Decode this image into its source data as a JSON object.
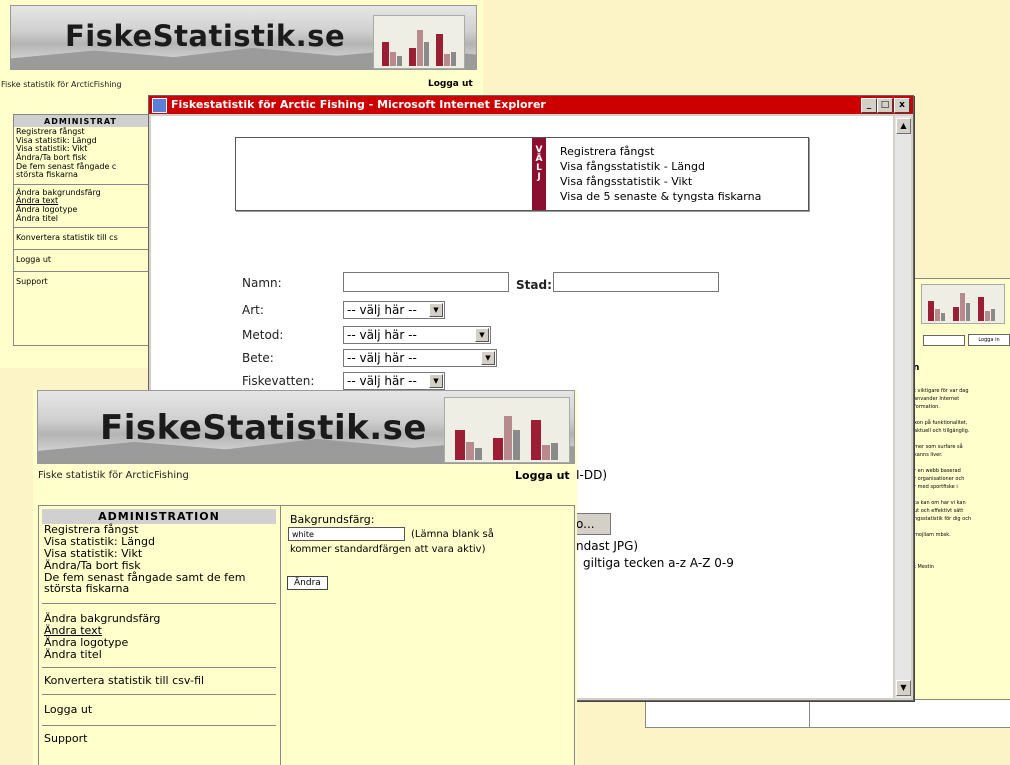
{
  "site": {
    "brand": "FiskeStatistik.se",
    "tagline": "Fiske statistik för ArcticFishing",
    "logout": "Logga ut"
  },
  "menu": {
    "heading": "ADMINISTRATION",
    "heading_cut": "ADMINISTRAT",
    "group1": [
      "Registrera fångst",
      "Visa statistik: Längd",
      "Visa statistik: Vikt",
      "Ändra/Ta bort fisk",
      "De fem senast fångade samt de fem",
      "största fiskarna"
    ],
    "group1_back_line5": "De fem senast fångade c",
    "group2": [
      "Ändra bakgrundsfärg",
      "Ändra text",
      "Ändra logotype",
      "Ändra titel"
    ],
    "convert": "Konvertera statistik till csv-fil",
    "convert_cut": "Konvertera statistik till cs",
    "logout": "Logga ut",
    "support": "Support"
  },
  "settings": {
    "label": "Bakgrundsfärg:",
    "value": "white",
    "hint1": "(Lämna blank så",
    "hint2": "kommer standardfärgen att vara aktiv)",
    "button": "Ändra"
  },
  "ie": {
    "title": "Fiskestatistik för Arctic Fishing - Microsoft Internet Explorer",
    "min": "_",
    "max": "□",
    "close": "x",
    "valj": [
      "V",
      "Ä",
      "L",
      "J"
    ],
    "nav": [
      "Registrera fångst",
      "Visa fångsstatistik - Längd",
      "Visa fångsstatistik - Vikt",
      "Visa de 5 senaste & tyngsta fiskarna"
    ],
    "form": {
      "namn": "Namn:",
      "stad": "Stad:",
      "art": "Art:",
      "metod": "Metod:",
      "bete": "Bete:",
      "fiskevatten": "Fiskevatten:",
      "select_short": "-- välj här --",
      "select_long": "-- välj här --",
      "arrow": "▼"
    },
    "fragments": {
      "date": "I-DD)",
      "browse": "o...",
      "jpg": "ndast JPG)",
      "chars": "giltiga tecken a-z A-Z 0-9"
    }
  },
  "right_window": {
    "login_btn": "Logga in",
    "heading": "n",
    "lines": [
      "t viktigare för var dag",
      "anvander Internet",
      "formation.",
      "",
      "xon på funktionalitet,",
      "aktuell och tillgänglig.",
      "",
      "mer som surfare så",
      "kanns liver.",
      "",
      "r en webb baserad",
      "r organisationer och",
      "r med sportfiske i",
      "",
      "ta kan om har vi kan",
      "ut och effektivt sätt",
      "ngsstatistik för dig och",
      "",
      "mojliam mbsk.",
      "",
      "",
      "",
      "t Mestin"
    ]
  }
}
